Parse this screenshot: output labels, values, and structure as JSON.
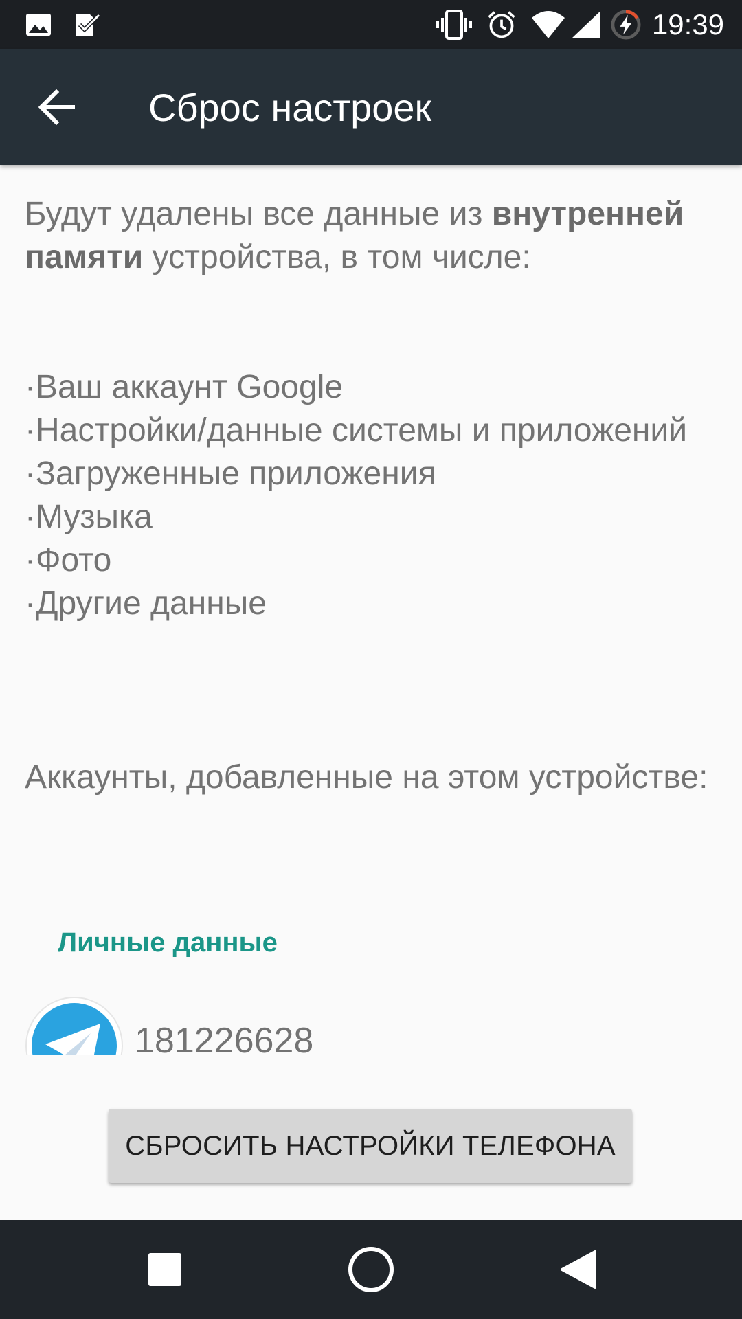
{
  "status_bar": {
    "time": "19:39",
    "icons": [
      "image-notification-icon",
      "check-notification-icon",
      "vibrate-icon",
      "alarm-icon",
      "wifi-icon",
      "cell-signal-icon",
      "battery-charging-icon"
    ]
  },
  "toolbar": {
    "title": "Сброс настроек",
    "back_icon": "arrow-back-icon"
  },
  "content": {
    "intro_prefix": "Будут удалены все данные из ",
    "intro_bold": "внутренней памяти",
    "intro_suffix": " устройства, в том числе:",
    "bullet_char": "·",
    "items": [
      "Ваш аккаунт Google",
      "Настройки/данные системы и приложений",
      "Загруженные приложения",
      "Музыка",
      "Фото",
      "Другие данные"
    ],
    "accounts_heading": "Аккаунты, добавленные на этом устройстве:",
    "section_label": "Личные данные",
    "account": {
      "name": "181226628",
      "icon": "telegram-icon",
      "color": "#2aa3e0"
    }
  },
  "reset_button": {
    "label": "СБРОСИТЬ НАСТРОЙКИ ТЕЛЕФОНА"
  },
  "nav_bar": {
    "icons": [
      "recents-square-icon",
      "home-circle-icon",
      "back-triangle-icon"
    ]
  },
  "colors": {
    "toolbar": "#263038",
    "status_bar": "#1c1f23",
    "accent": "#1b9688",
    "body_text": "#737373",
    "button": "#d6d6d6"
  }
}
